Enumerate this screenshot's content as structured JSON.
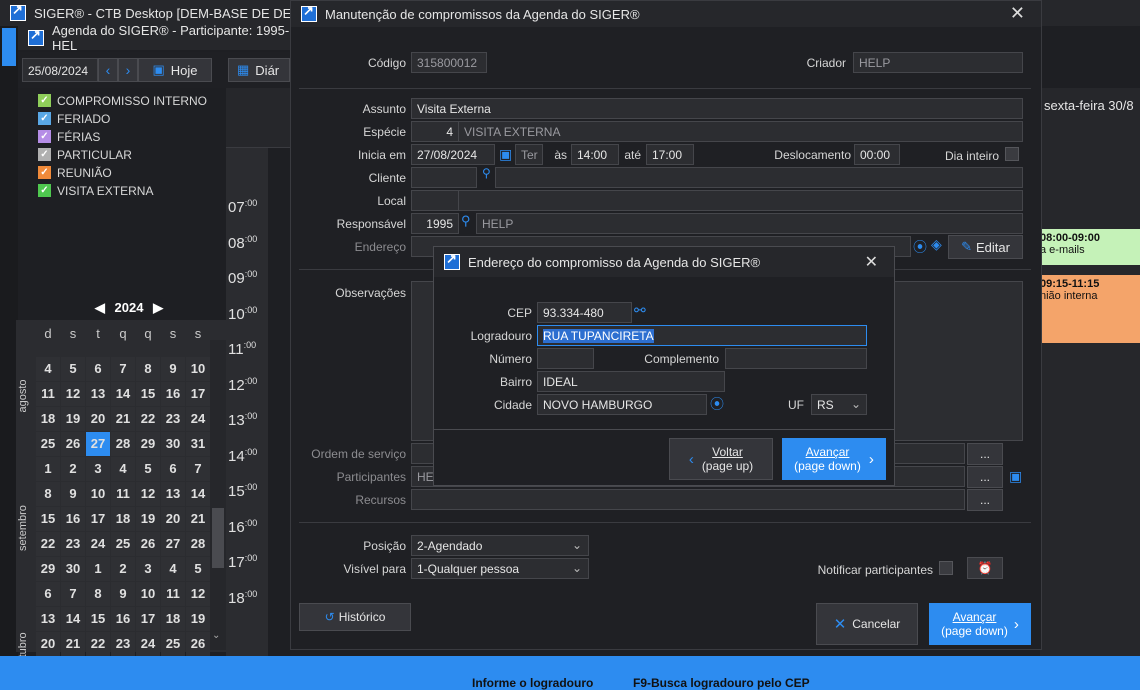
{
  "main_window": {
    "title": "SIGER® - CTB Desktop [DEM-BASE DE DEMON"
  },
  "agenda_window": {
    "title": "Agenda do SIGER® - Participante: 1995-HEL",
    "date": "25/08/2024",
    "today_label": "Hoje",
    "view_label": "Diár",
    "day_header": "sexta-feira 30/8",
    "categories": [
      {
        "label": "COMPROMISSO INTERNO",
        "color": "#8fce5a"
      },
      {
        "label": "FERIADO",
        "color": "#5aa8e6"
      },
      {
        "label": "FÉRIAS",
        "color": "#b58de6"
      },
      {
        "label": "PARTICULAR",
        "color": "#b0b0b0"
      },
      {
        "label": "REUNIÃO",
        "color": "#f08a3a"
      },
      {
        "label": "VISITA EXTERNA",
        "color": "#4fc84f"
      }
    ],
    "hours": [
      "07",
      "08",
      "09",
      "10",
      "11",
      "12",
      "13",
      "14",
      "15",
      "16",
      "17",
      "18"
    ],
    "hour_suffix": ":00",
    "event1": {
      "time": "08:00-09:00",
      "text": "a e-mails"
    },
    "event2": {
      "time": "09:15-11:15",
      "text": "nião interna"
    },
    "calendar": {
      "year": "2024",
      "weekdays": [
        "d",
        "s",
        "t",
        "q",
        "q",
        "s",
        "s"
      ],
      "months": [
        "agosto",
        "setembro",
        "outubro"
      ],
      "weeks": [
        [
          "4",
          "5",
          "6",
          "7",
          "8",
          "9",
          "10"
        ],
        [
          "11",
          "12",
          "13",
          "14",
          "15",
          "16",
          "17"
        ],
        [
          "18",
          "19",
          "20",
          "21",
          "22",
          "23",
          "24"
        ],
        [
          "25",
          "26",
          "27",
          "28",
          "29",
          "30",
          "31"
        ],
        [
          "1",
          "2",
          "3",
          "4",
          "5",
          "6",
          "7"
        ],
        [
          "8",
          "9",
          "10",
          "11",
          "12",
          "13",
          "14"
        ],
        [
          "15",
          "16",
          "17",
          "18",
          "19",
          "20",
          "21"
        ],
        [
          "22",
          "23",
          "24",
          "25",
          "26",
          "27",
          "28"
        ],
        [
          "29",
          "30",
          "1",
          "2",
          "3",
          "4",
          "5"
        ],
        [
          "6",
          "7",
          "8",
          "9",
          "10",
          "11",
          "12"
        ],
        [
          "13",
          "14",
          "15",
          "16",
          "17",
          "18",
          "19"
        ],
        [
          "20",
          "21",
          "22",
          "23",
          "24",
          "25",
          "26"
        ]
      ],
      "selected": "27"
    }
  },
  "dialog": {
    "title": "Manutenção de compromissos da Agenda do SIGER®",
    "codigo_label": "Código",
    "codigo": "315800012",
    "criador_label": "Criador",
    "criador": "HELP",
    "assunto_label": "Assunto",
    "assunto": "Visita Externa",
    "especie_label": "Espécie",
    "especie_code": "4",
    "especie_name": "VISITA EXTERNA",
    "inicia_label": "Inicia em",
    "inicia_date": "27/08/2024",
    "inicia_day": "Ter",
    "as_label": "às",
    "start_time": "14:00",
    "ate_label": "até",
    "end_time": "17:00",
    "deslocamento_label": "Deslocamento",
    "deslocamento": "00:00",
    "dia_inteiro_label": "Dia inteiro",
    "cliente_label": "Cliente",
    "local_label": "Local",
    "responsavel_label": "Responsável",
    "responsavel_code": "1995",
    "responsavel_name": "HELP",
    "endereco_label": "Endereço",
    "editar_label": "Editar",
    "observacoes_label": "Observações",
    "ordem_label": "Ordem de serviço",
    "participantes_label": "Participantes",
    "participantes_value": "HEL",
    "recursos_label": "Recursos",
    "ellipsis": "...",
    "posicao_label": "Posição",
    "posicao": "2-Agendado",
    "visivel_label": "Visível para",
    "visivel": "1-Qualquer pessoa",
    "notificar_label": "Notificar participantes",
    "historico_label": "Histórico",
    "cancelar_label": "Cancelar",
    "avancar_label": "Avançar",
    "avancar_sub": "(page down)"
  },
  "address_dialog": {
    "title": "Endereço do compromisso da Agenda do SIGER®",
    "cep_label": "CEP",
    "cep": "93.334-480",
    "logradouro_label": "Logradouro",
    "logradouro": "RUA TUPANCIRETA",
    "numero_label": "Número",
    "complemento_label": "Complemento",
    "bairro_label": "Bairro",
    "bairro": "IDEAL",
    "cidade_label": "Cidade",
    "cidade": "NOVO HAMBURGO",
    "uf_label": "UF",
    "uf": "RS",
    "voltar_label": "Voltar",
    "voltar_sub": "(page up)",
    "avancar_label": "Avançar",
    "avancar_sub": "(page down)"
  },
  "status_bar": {
    "hint": "Informe o logradouro",
    "shortcut": "F9-Busca logradouro pelo CEP"
  }
}
